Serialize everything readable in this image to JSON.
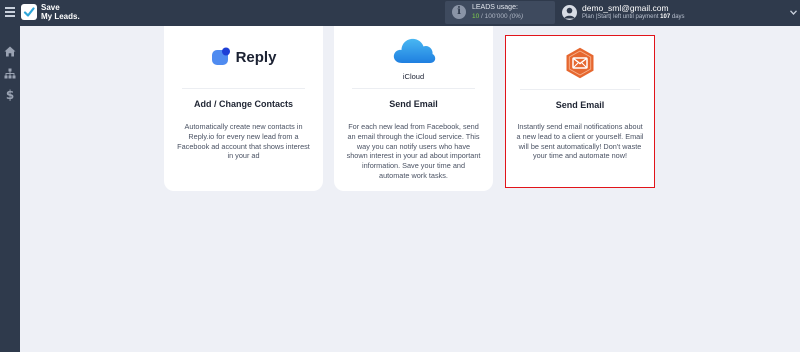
{
  "brand": {
    "line1": "Save",
    "line2": "My Leads."
  },
  "leads": {
    "label": "LEADS usage:",
    "used": "10",
    "total": "/ 100'000",
    "percent": "(0%)"
  },
  "user": {
    "email": "demo_sml@gmail.com",
    "plan_prefix": "Plan |Start| left until payment",
    "days_number": "107",
    "days_suffix": "days"
  },
  "sidebar": {
    "items": [
      {
        "icon": "home-icon"
      },
      {
        "icon": "sitemap-icon"
      },
      {
        "icon": "dollar-icon"
      }
    ]
  },
  "cards": [
    {
      "brand_word": "Reply",
      "title": "Add / Change Contacts",
      "description": "Automatically create new contacts in Reply.io for every new lead from a Facebook ad account that shows interest in your ad"
    },
    {
      "brand_word": "iCloud",
      "title": "Send Email",
      "description": "For each new lead from Facebook, send an email through the iCloud service. This way you can notify users who have shown interest in your ad about important information. Save your time and automate work tasks."
    },
    {
      "title": "Send Email",
      "description": "Instantly send email notifications about a new lead to a client or yourself. Email will be sent automatically! Don't waste your time and automate now!",
      "selected": true
    }
  ],
  "colors": {
    "topbar": "#2f3a4c",
    "accent_green": "#7fcf4a",
    "selection_border": "#e1141a",
    "email_icon_orange": "#e6672f"
  }
}
